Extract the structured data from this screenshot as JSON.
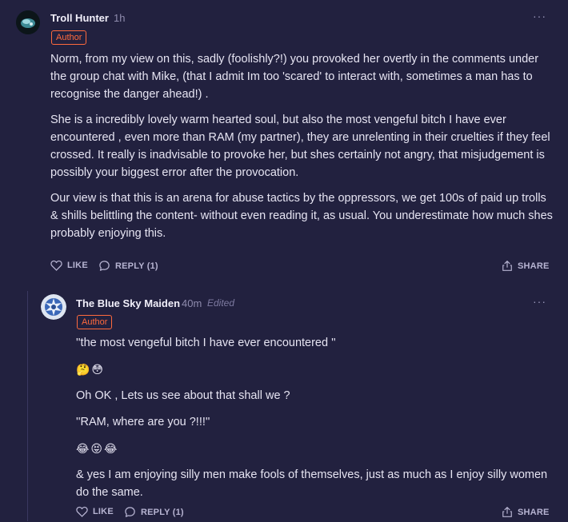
{
  "comments": [
    {
      "author": "Troll Hunter",
      "time": "1h",
      "badge": "Author",
      "paragraphs": [
        "Norm, from my view on this, sadly (foolishly?!) you provoked her overtly in the comments under the group chat with Mike, (that I admit Im too 'scared' to interact with, sometimes a man has to recognise the danger ahead!) .",
        "She is a incredibly lovely warm hearted soul, but also the most vengeful bitch I have ever encountered , even more than RAM (my partner), they are unrelenting in their cruelties if they feel crossed. It really is inadvisable to provoke her, but shes certainly not angry, that misjudgement is possibly your biggest error after the provocation.",
        "Our view is that this is an arena for abuse tactics by the oppressors, we get 100s of paid up trolls & shills belittling the content- without even reading it, as usual. You underestimate how much shes probably enjoying this."
      ],
      "like_label": "LIKE",
      "reply_label": "REPLY (1)",
      "share_label": "SHARE",
      "more_label": "···"
    },
    {
      "author": "The Blue Sky Maiden",
      "time": "40m",
      "edited": "Edited",
      "badge": "Author",
      "lines": [
        "''the most vengeful bitch I have ever encountered ''",
        "🤔😳",
        "Oh OK , Lets us see about that shall we ?",
        "''RAM, where are you ?!!!''",
        "😂😝😂",
        "& yes I am enjoying silly men make fools of themselves, just as much as I enjoy silly women do the same."
      ],
      "like_label": "LIKE",
      "reply_label": "REPLY (1)",
      "share_label": "SHARE",
      "more_label": "···"
    }
  ],
  "icons": {
    "like": "heart-icon",
    "reply": "speech-bubble-icon",
    "share": "share-icon",
    "more": "more-options-icon"
  },
  "colors": {
    "background": "#22213f",
    "badge": "#ff6a3d",
    "muted": "#8f8cae",
    "text": "#e6e4f2"
  }
}
